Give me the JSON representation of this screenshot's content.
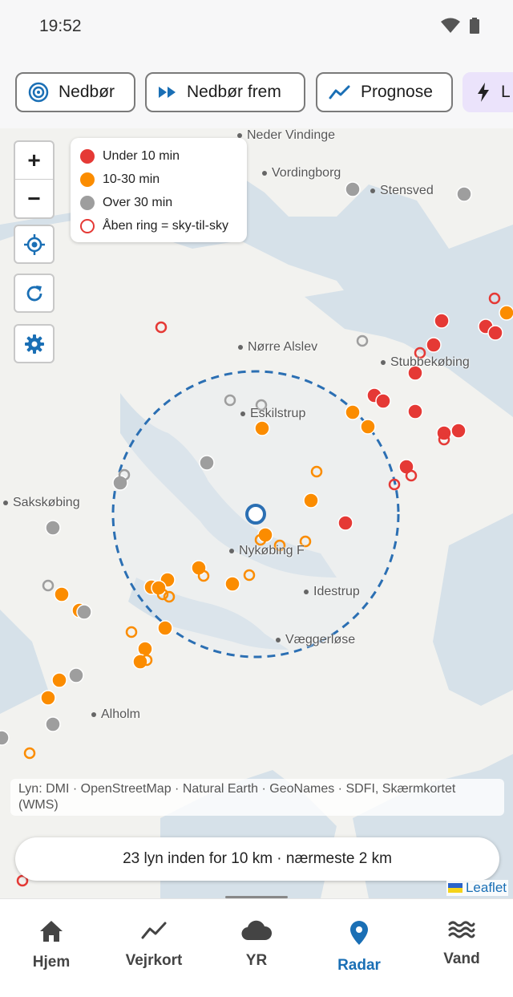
{
  "status": {
    "time": "19:52",
    "wifi_icon": "wifi-icon",
    "battery_icon": "battery-icon"
  },
  "chips": [
    {
      "label": "Nedbør",
      "icon": "radar-icon"
    },
    {
      "label": "Nedbør frem",
      "icon": "fast-forward-icon"
    },
    {
      "label": "Prognose",
      "icon": "trend-line-icon"
    },
    {
      "label": "L",
      "icon": "lightning-icon"
    }
  ],
  "map": {
    "places": [
      {
        "name": "Neder Vindinge"
      },
      {
        "name": "Vordingborg"
      },
      {
        "name": "Stensved"
      },
      {
        "name": "Nørre Alslev"
      },
      {
        "name": "Stubbekøbing"
      },
      {
        "name": "Eskilstrup"
      },
      {
        "name": "Sakskøbing"
      },
      {
        "name": "Nykøbing F"
      },
      {
        "name": "Idestrup"
      },
      {
        "name": "Væggerløse"
      },
      {
        "name": "Alholm"
      }
    ],
    "controls": {
      "zoom_in": "+",
      "zoom_out": "−",
      "locate_icon": "locate-icon",
      "refresh_icon": "refresh-icon",
      "settings_icon": "gear-icon"
    },
    "legend": [
      {
        "label": "Under 10 min",
        "color": "#e53935",
        "style": "filled"
      },
      {
        "label": "10-30 min",
        "color": "#fb8c00",
        "style": "filled"
      },
      {
        "label": "Over 30 min",
        "color": "#9e9e9e",
        "style": "filled"
      },
      {
        "label": "Åben ring = sky-til-sky",
        "color": "#e53935",
        "style": "ring"
      }
    ],
    "attribution": "Lyn: DMI · OpenStreetMap · Natural Earth · GeoNames · SDFI, Skærmkortet (WMS)",
    "leaflet": "Leaflet",
    "summary": "23 lyn inden for 10 km · nærmeste 2 km"
  },
  "nav": [
    {
      "label": "Hjem",
      "icon": "home-icon"
    },
    {
      "label": "Vejrkort",
      "icon": "chart-line-icon"
    },
    {
      "label": "YR",
      "icon": "cloud-icon"
    },
    {
      "label": "Radar",
      "icon": "location-pin-icon"
    },
    {
      "label": "Vand",
      "icon": "waves-icon"
    }
  ],
  "colors": {
    "accent": "#1a6fb5",
    "red": "#e53935",
    "orange": "#fb8c00",
    "grey": "#9e9e9e"
  }
}
